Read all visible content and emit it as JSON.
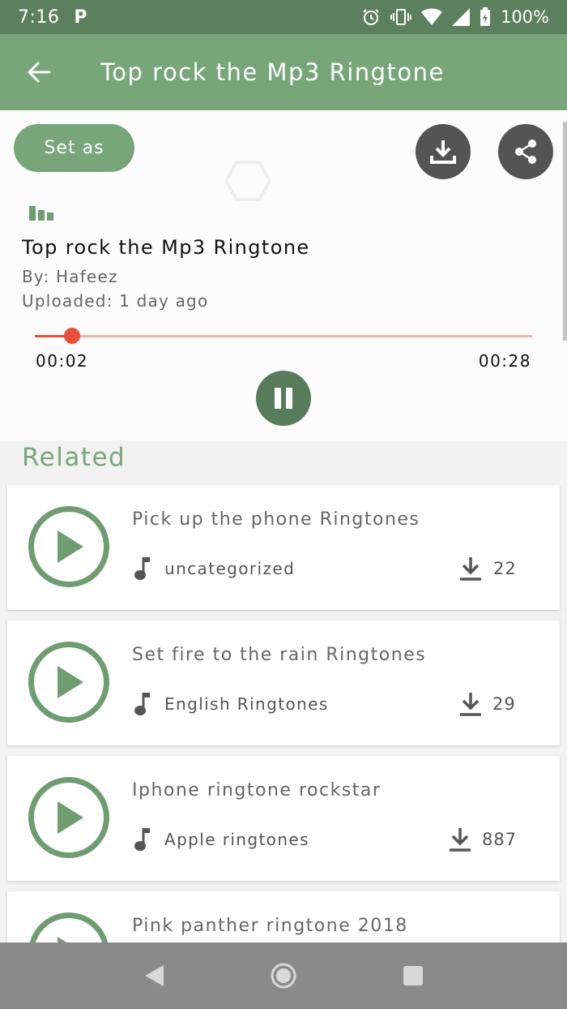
{
  "status_bar": {
    "time": "7:16",
    "notif_letter": "P",
    "battery_text": "100%"
  },
  "app_bar": {
    "title": "Top rock the Mp3 Ringtone"
  },
  "player": {
    "set_as_label": "Set as",
    "track_title": "Top rock the Mp3 Ringtone",
    "by": "By: Hafeez",
    "uploaded": "Uploaded: 1 day ago",
    "current_time": "00:02",
    "total_time": "00:28",
    "progress": 0.075
  },
  "related": {
    "heading": "Related",
    "items": [
      {
        "name": "Pick up the phone Ringtones",
        "category": "uncategorized",
        "downloads": "22"
      },
      {
        "name": "Set fire to the rain Ringtones",
        "category": "English Ringtones",
        "downloads": "29"
      },
      {
        "name": "Iphone ringtone rockstar",
        "category": "Apple ringtones",
        "downloads": "887"
      },
      {
        "name": "Pink panther ringtone 2018",
        "category": "",
        "downloads": ""
      }
    ]
  },
  "colors": {
    "status_bar": "#5c7f5d",
    "app_bar": "#78a67a",
    "accent_red": "#e8503a",
    "dark_button": "#545454",
    "pause_button": "#587c5b"
  },
  "icons": {
    "back": "arrow-left-icon",
    "download": "download-icon",
    "share": "share-icon",
    "pause": "pause-icon",
    "play": "play-icon",
    "note": "music-note-icon"
  }
}
